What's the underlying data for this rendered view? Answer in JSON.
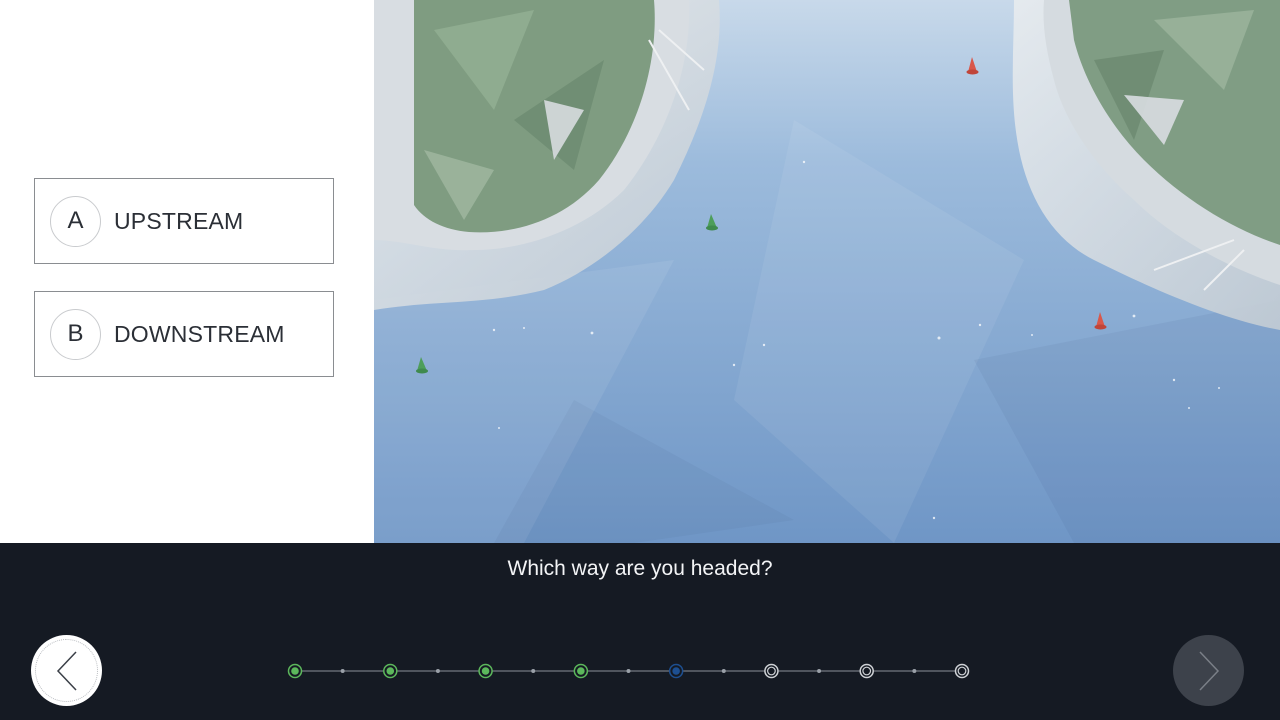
{
  "answers": [
    {
      "letter": "A",
      "label": "UPSTREAM"
    },
    {
      "letter": "B",
      "label": "DOWNSTREAM"
    }
  ],
  "question": "Which way are you headed?",
  "navigation": {
    "back_icon": "chevron-left-icon",
    "next_icon": "chevron-right-icon",
    "next_enabled": false
  },
  "progress": {
    "total_steps": 8,
    "current_step": 5,
    "step_states": [
      "completed",
      "completed",
      "completed",
      "completed",
      "current",
      "upcoming",
      "upcoming",
      "upcoming"
    ]
  },
  "colors": {
    "bottom_bar": "#151a23",
    "completed": "#5cb85c",
    "current": "#1d4f91",
    "upcoming": "#cfd2d6",
    "buoy_green": "#4d9e5a",
    "buoy_red": "#d9574a",
    "water": "#7ea3cf",
    "land": "#8fa88e"
  }
}
